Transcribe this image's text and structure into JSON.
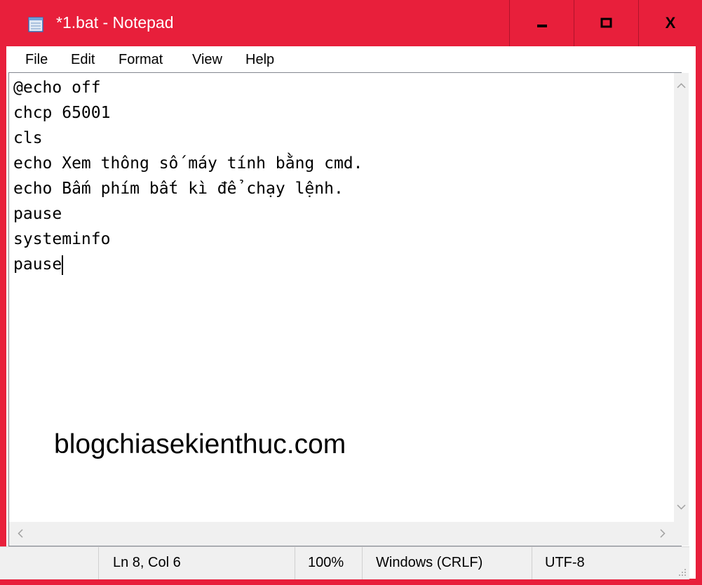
{
  "window": {
    "title": "*1.bat - Notepad",
    "accent": "#e81f3b"
  },
  "titlebar_buttons": {
    "minimize": "minimize-icon",
    "maximize": "maximize-icon",
    "close_label": "X"
  },
  "menu": [
    "File",
    "Edit",
    "Format",
    "View",
    "Help"
  ],
  "editor": {
    "lines": [
      "@echo off",
      "chcp 65001",
      "cls",
      "echo Xem thông số máy tính bằng cmd.",
      "echo Bấm phím bất kì để chạy lệnh.",
      "pause",
      "systeminfo",
      "pause"
    ]
  },
  "watermark": "blogchiasekienthuc.com",
  "scrollbars": {
    "up": "^",
    "down": "v",
    "left": "<",
    "right": ">"
  },
  "status": {
    "position": "Ln 8, Col 6",
    "zoom": "100%",
    "line_endings": "Windows (CRLF)",
    "encoding": "UTF-8"
  }
}
